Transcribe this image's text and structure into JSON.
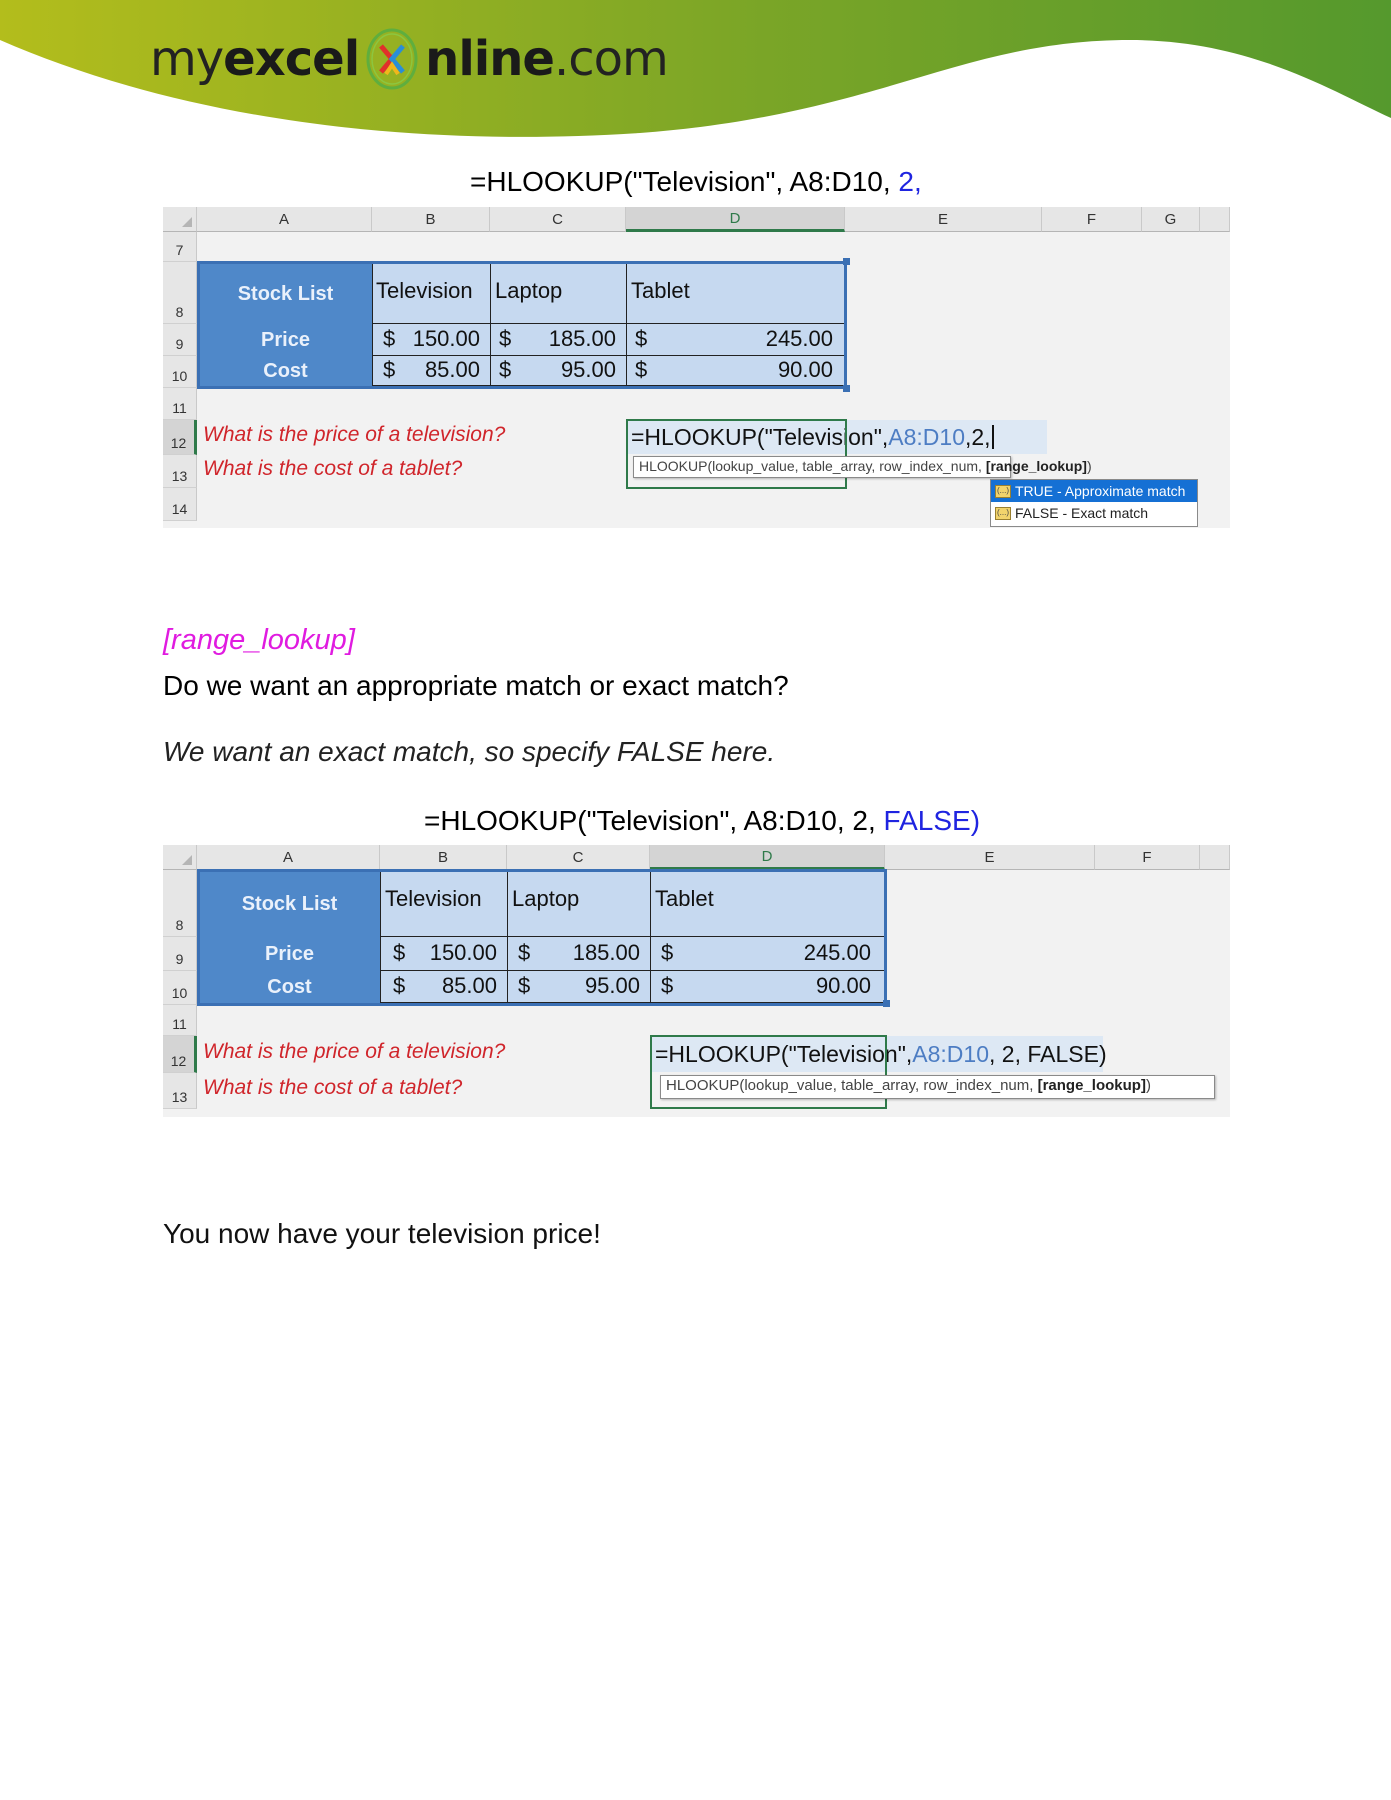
{
  "header": {
    "logo": {
      "part1": "my",
      "part2": "excel",
      "part3": "nline",
      "part4": ".com"
    },
    "brand_colors": {
      "banner_start": "#b3bd1c",
      "banner_end": "#55992d"
    }
  },
  "section1": {
    "title_prefix": "=HLOOKUP(\"Television\", A8:D10, ",
    "title_highlight": "2,",
    "sheet": {
      "columns": [
        "A",
        "B",
        "C",
        "D",
        "E",
        "F",
        "G"
      ],
      "selected_column": "D",
      "rows": [
        "7",
        "8",
        "9",
        "10",
        "11",
        "12",
        "13",
        "14"
      ],
      "table": {
        "header": [
          "Stock List",
          "Television",
          "Laptop",
          "Tablet"
        ],
        "price": {
          "label": "Price",
          "values": [
            {
              "cur": "$",
              "amt": "150.00"
            },
            {
              "cur": "$",
              "amt": "185.00"
            },
            {
              "cur": "$",
              "amt": "245.00"
            }
          ]
        },
        "cost": {
          "label": "Cost",
          "values": [
            {
              "cur": "$",
              "amt": "85.00"
            },
            {
              "cur": "$",
              "amt": "95.00"
            },
            {
              "cur": "$",
              "amt": "90.00"
            }
          ]
        }
      },
      "question1": "What is the price of a television?",
      "question2": "What is the cost of a tablet?",
      "formula": {
        "prefix": "=HLOOKUP(\"Television\",",
        "ref": "A8:D10",
        "suffix": ",2,"
      },
      "tooltip": {
        "text": "HLOOKUP(lookup_value, table_array, row_index_num, ",
        "bold": "[range_lookup]",
        "end": ")"
      },
      "autocomplete": [
        {
          "label": "TRUE - Approximate match",
          "highlighted": true
        },
        {
          "label": "FALSE - Exact match",
          "highlighted": false
        }
      ]
    }
  },
  "section2": {
    "param_name": "[range_lookup]",
    "question": "Do we want an appropriate match or exact match?",
    "answer": "We want an exact match, so specify FALSE here.",
    "title_prefix": "=HLOOKUP(\"Television\", A8:D10, 2, ",
    "title_highlight": "FALSE)",
    "sheet": {
      "columns": [
        "A",
        "B",
        "C",
        "D",
        "E",
        "F"
      ],
      "selected_column": "D",
      "rows": [
        "8",
        "9",
        "10",
        "11",
        "12",
        "13"
      ],
      "table": {
        "header": [
          "Stock List",
          "Television",
          "Laptop",
          "Tablet"
        ],
        "price": {
          "label": "Price",
          "values": [
            {
              "cur": "$",
              "amt": "150.00"
            },
            {
              "cur": "$",
              "amt": "185.00"
            },
            {
              "cur": "$",
              "amt": "245.00"
            }
          ]
        },
        "cost": {
          "label": "Cost",
          "values": [
            {
              "cur": "$",
              "amt": "85.00"
            },
            {
              "cur": "$",
              "amt": "95.00"
            },
            {
              "cur": "$",
              "amt": "90.00"
            }
          ]
        }
      },
      "question1": "What is the price of a television?",
      "question2": "What is the cost of a tablet?",
      "formula": {
        "prefix": "=HLOOKUP(\"Television\", ",
        "ref": "A8:D10",
        "suffix": ", 2, FALSE)"
      },
      "tooltip": {
        "text": "HLOOKUP(lookup_value, table_array, row_index_num, ",
        "bold": "[range_lookup]",
        "end": ")"
      }
    }
  },
  "conclusion": "You now have your television price!"
}
